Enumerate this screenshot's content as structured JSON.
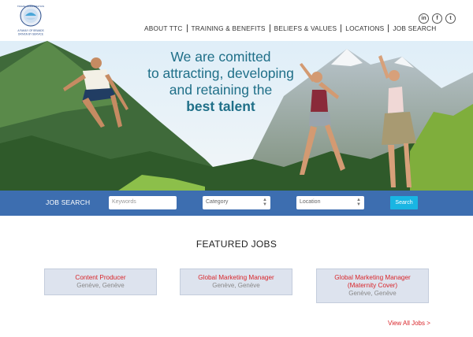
{
  "header": {
    "logo_text": {
      "top": "TRAVEL CORPORATION",
      "line1": "A FAMILY OF BRANDS",
      "line2": "DRIVEN BY SERVICE"
    },
    "nav": [
      {
        "label": "ABOUT TTC"
      },
      {
        "label": "TRAINING & BENEFITS"
      },
      {
        "label": "BELIEFS & VALUES"
      },
      {
        "label": "LOCATIONS"
      },
      {
        "label": "JOB SEARCH"
      }
    ],
    "social": [
      {
        "label": "in",
        "icon": "linkedin-icon"
      },
      {
        "label": "f",
        "icon": "facebook-icon"
      },
      {
        "label": "t",
        "icon": "twitter-icon"
      }
    ]
  },
  "hero": {
    "line1": "We are comitted",
    "line2": "to attracting, developing",
    "line3": "and retaining the",
    "line4": "best talent",
    "text_color": "#1f6f88"
  },
  "search": {
    "label": "JOB SEARCH",
    "keywords_placeholder": "Keywords",
    "category": "Category",
    "location": "Location",
    "button": "Search",
    "bar_color": "#3d6eb0",
    "button_color": "#19b5e3"
  },
  "featured": {
    "title": "FEATURED JOBS",
    "jobs": [
      {
        "title": "Content Producer",
        "title2": "",
        "location": "Genève, Genève"
      },
      {
        "title": "Global Marketing Manager",
        "title2": "",
        "location": "Genève, Genève"
      },
      {
        "title": "Global Marketing Manager",
        "title2": "(Maternity Cover)",
        "location": "Genève, Genève"
      }
    ],
    "view_all": "View All Jobs >",
    "accent_color": "#d9252a"
  }
}
